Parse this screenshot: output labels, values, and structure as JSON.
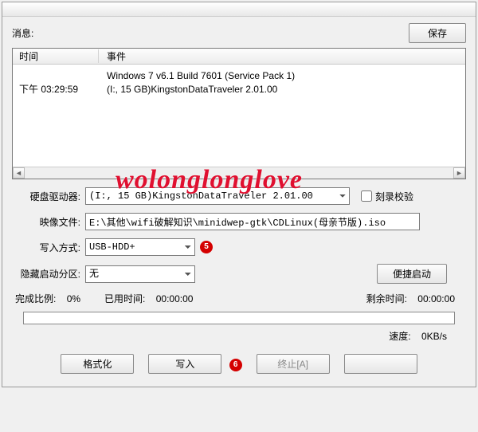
{
  "top": {
    "message_label": "消息:",
    "save_btn": "保存"
  },
  "table": {
    "col_time": "时间",
    "col_event": "事件",
    "row": {
      "time": "下午 03:29:59",
      "event_line1": "Windows 7 v6.1 Build 7601 (Service Pack 1)",
      "event_line2": "(I:, 15 GB)KingstonDataTraveler 2.01.00"
    }
  },
  "watermark": "wolonglonglove",
  "labels": {
    "drive": "硬盘驱动器:",
    "verify": "刻录校验",
    "image": "映像文件:",
    "write_mode": "写入方式:",
    "hidden_part": "隐藏启动分区:",
    "portable_btn": "便捷启动",
    "done_pct": "完成比例:",
    "elapsed": "已用时间:",
    "remain": "剩余时间:",
    "speed": "速度:"
  },
  "values": {
    "drive_selected": "(I:, 15 GB)KingstonDataTraveler 2.01.00",
    "image_path": "E:\\其他\\wifi破解知识\\minidwep-gtk\\CDLinux(母亲节版).iso",
    "write_mode_selected": "USB-HDD+",
    "hidden_selected": "无",
    "done_pct_val": "0%",
    "elapsed_val": "00:00:00",
    "remain_val": "00:00:00",
    "speed_val": "0KB/s"
  },
  "callouts": {
    "c5": "5",
    "c6": "6"
  },
  "buttons": {
    "format": "格式化",
    "write": "写入",
    "abort": "终止[A]"
  }
}
